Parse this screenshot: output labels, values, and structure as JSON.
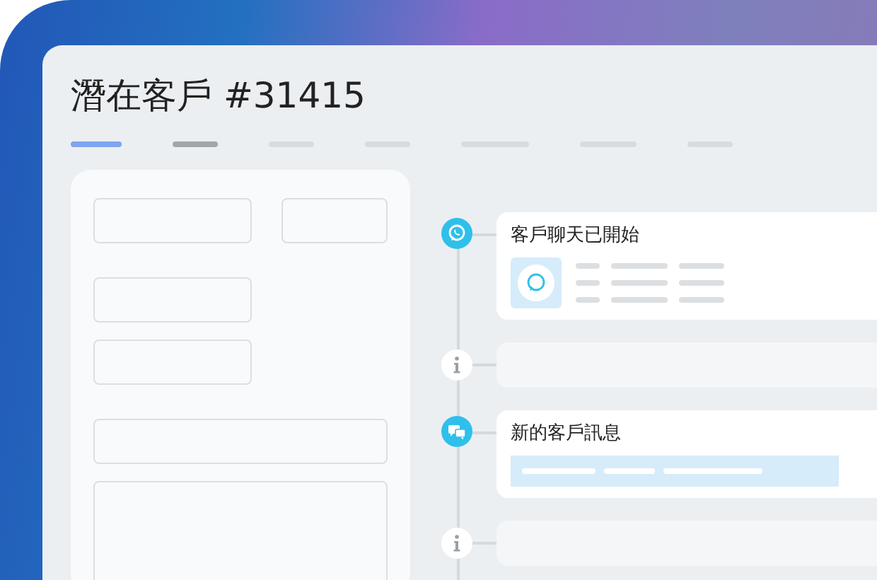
{
  "window": {
    "title": "潛在客戶 #31415"
  },
  "tabs": [
    {
      "selected": true
    },
    {
      "selected": false
    },
    {
      "selected": false
    },
    {
      "selected": false
    },
    {
      "selected": false
    },
    {
      "selected": false
    },
    {
      "selected": false
    }
  ],
  "timeline": [
    {
      "kind": "whatsapp",
      "title": "客戶聊天已開始"
    },
    {
      "kind": "info"
    },
    {
      "kind": "message",
      "title": "新的客戶訊息"
    },
    {
      "kind": "info"
    }
  ]
}
